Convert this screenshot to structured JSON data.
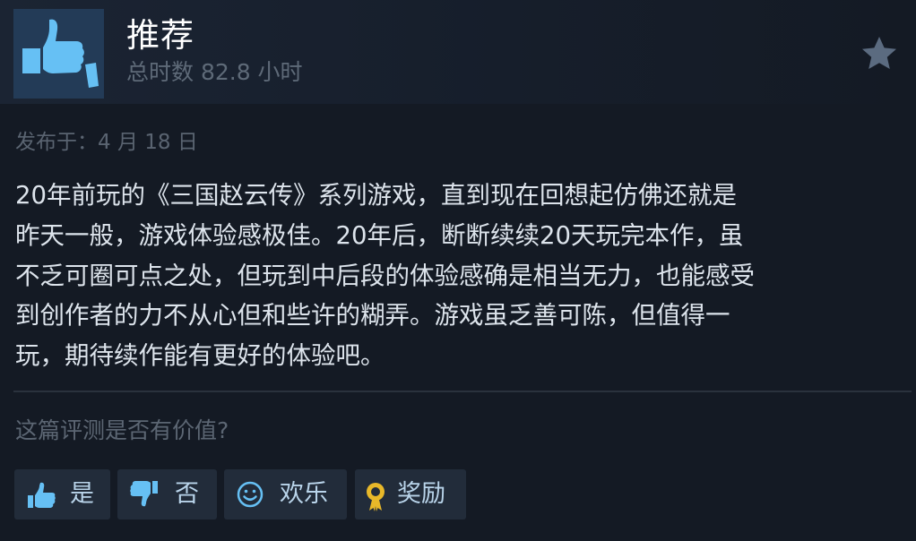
{
  "header": {
    "recommendation": "推荐",
    "hours": "总时数 82.8 小时",
    "icon": "thumbs-up-icon"
  },
  "posted": "发布于：4 月 18 日",
  "review_lines": [
    "20年前玩的《三国赵云传》系列游戏，直到现在回想起仿佛还就是",
    "昨天一般，游戏体验感极佳。20年后，断断续续20天玩完本作，虽",
    "不乏可圈可点之处，但玩到中后段的体验感确是相当无力，也能感受",
    "到创作者的力不从心但和些许的糊弄。游戏虽乏善可陈，但值得一",
    "玩，期待续作能有更好的体验吧。"
  ],
  "helpful_question": "这篇评测是否有价值?",
  "buttons": {
    "yes": "是",
    "no": "否",
    "funny": "欢乐",
    "award": "奖励"
  },
  "colors": {
    "background": "#141a24",
    "icon_blue": "#66c0f4",
    "button_bg": "#222c3a",
    "button_text": "#b9d4ea",
    "award_gold": "#e8b829"
  }
}
